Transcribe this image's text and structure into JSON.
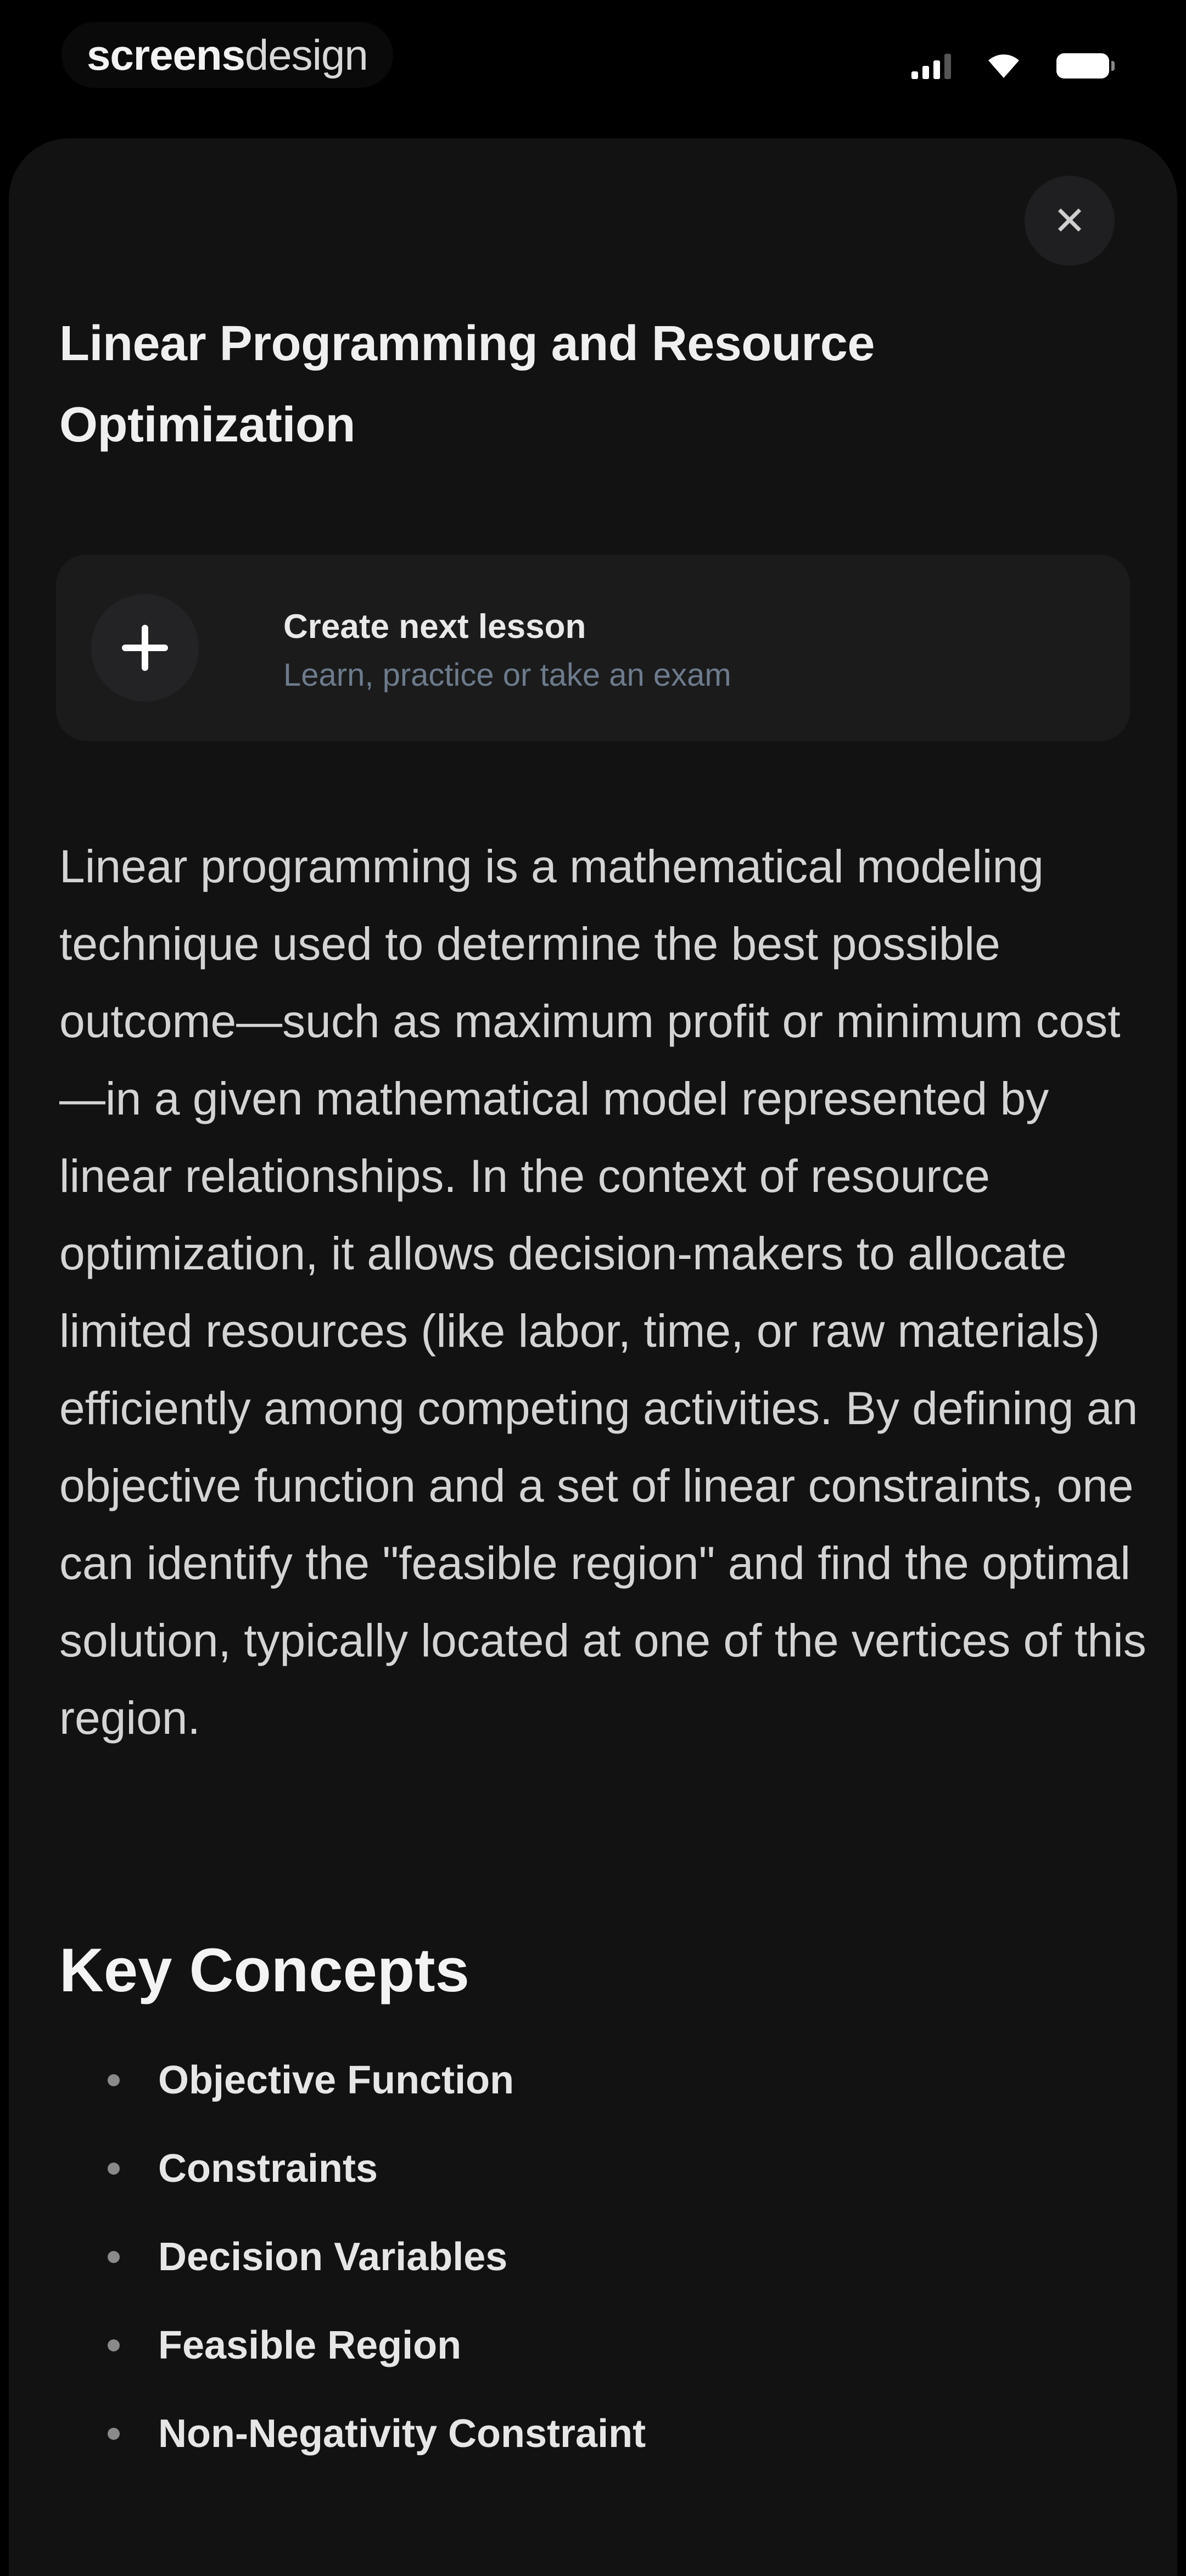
{
  "status_bar": {
    "brand_bold": "screens",
    "brand_light": "design",
    "icons": [
      "signal-icon",
      "wifi-icon",
      "battery-icon"
    ]
  },
  "sheet": {
    "close_icon": "close-icon",
    "title": "Linear Programming and Resource Optimization",
    "lesson_card": {
      "icon": "plus-icon",
      "title": "Create next lesson",
      "subtitle": "Learn, practice or take an exam"
    },
    "body": "Linear programming is a mathematical modeling technique used to determine the best possible outcome—such as maximum profit or minimum cost—in a given mathematical model represented by linear relationships. In the context of resource optimization, it allows decision-makers to allocate limited resources (like labor, time, or raw materials) efficiently among competing activities. By defining an objective function and a set of linear constraints, one can identify the \"feasible region\" and find the optimal solution, typically located at one of the vertices of this region.",
    "key_concepts": {
      "heading": "Key Concepts",
      "items": [
        "Objective Function",
        "Constraints",
        "Decision Variables",
        "Feasible Region",
        "Non-Negativity Constraint"
      ]
    }
  },
  "colors": {
    "background": "#000000",
    "sheet": "#121213",
    "card": "#1b1b1c",
    "subtitle": "#6d7b8c"
  }
}
